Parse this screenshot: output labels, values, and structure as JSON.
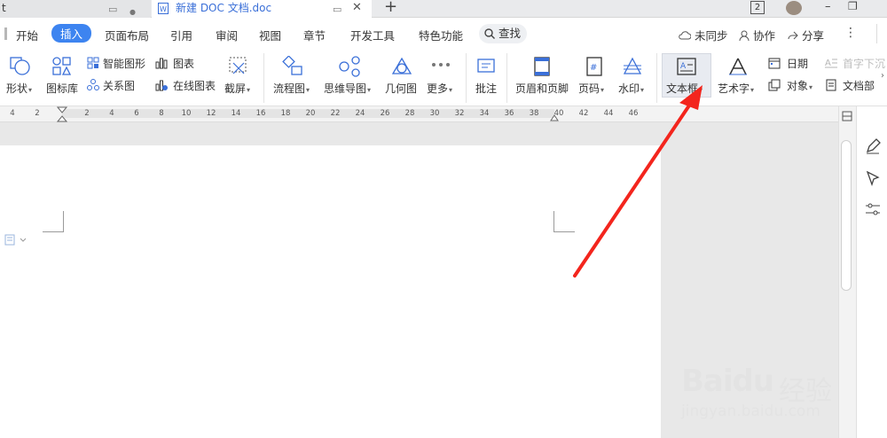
{
  "tabs": [
    {
      "label": "t",
      "state": "inactive"
    },
    {
      "label": "新建 DOC 文档.doc",
      "state": "active"
    }
  ],
  "tab_controls": {
    "pin": "▭",
    "dot": "●",
    "close": "✕",
    "new": "+"
  },
  "window": {
    "badge": "2",
    "min": "–",
    "restore": "❐"
  },
  "menu": {
    "items": [
      "开始",
      "插入",
      "页面布局",
      "引用",
      "审阅",
      "视图",
      "章节",
      "开发工具",
      "特色功能"
    ],
    "active_index": 1,
    "search_label": "查找",
    "right": {
      "sync": "未同步",
      "collab": "协作",
      "share": "分享",
      "more": "⋮"
    }
  },
  "ribbon": {
    "shape": "形状",
    "iconlib": "图标库",
    "smartart": "智能图形",
    "relation": "关系图",
    "chart": "图表",
    "onlinechart": "在线图表",
    "screenshot": "截屏",
    "flow": "流程图",
    "mindmap": "思维导图",
    "geometry": "几何图",
    "more": "更多",
    "comment": "批注",
    "headerfooter": "页眉和页脚",
    "pagenum": "页码",
    "watermark": "水印",
    "textbox": "文本框",
    "wordart": "艺术字",
    "date": "日期",
    "object": "对象",
    "dropcap": "首字下沉",
    "docpart": "文档部"
  },
  "ruler": {
    "left_numbers": [
      "4",
      "2"
    ],
    "numbers": [
      "2",
      "4",
      "6",
      "8",
      "10",
      "12",
      "14",
      "16",
      "18",
      "20",
      "22",
      "24",
      "26",
      "28",
      "30",
      "32",
      "34",
      "36",
      "38",
      "40",
      "42",
      "44",
      "46"
    ]
  },
  "watermark": {
    "brand": "Baidu",
    "cn": "经验",
    "url": "jingyan.baidu.com"
  },
  "colors": {
    "accent": "#3d84f0",
    "arrow": "#f3251d"
  }
}
